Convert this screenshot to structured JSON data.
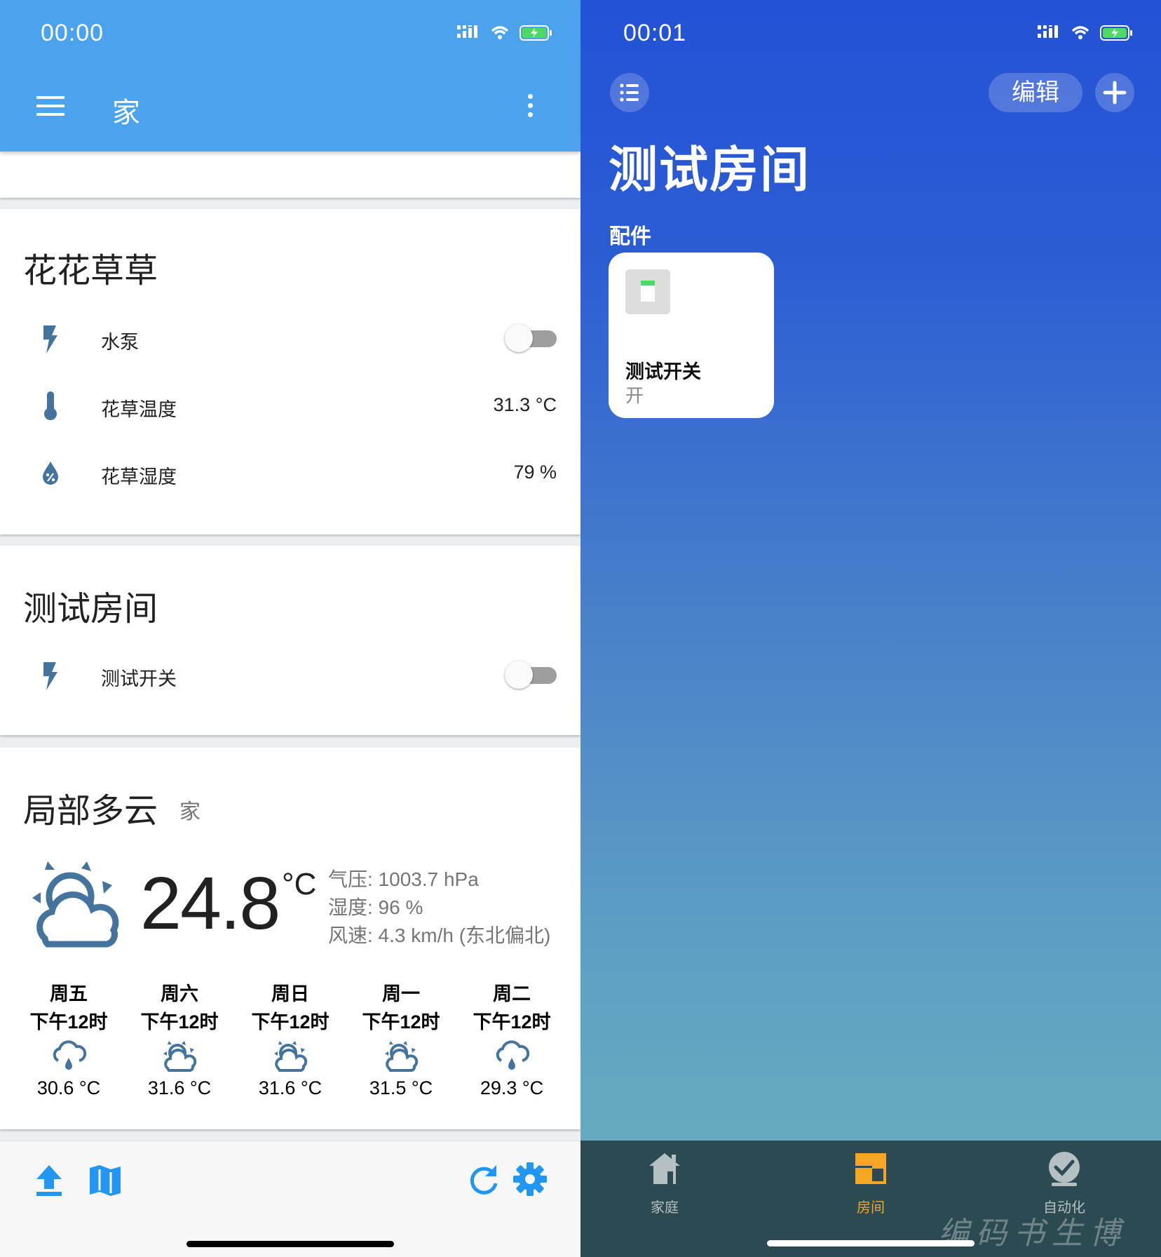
{
  "left": {
    "status": {
      "time": "00:00"
    },
    "header": {
      "title": "家"
    },
    "cards": [
      {
        "title": "花花草草",
        "rows": [
          {
            "icon": "flash-icon",
            "label": "水泵",
            "type": "toggle",
            "state": "off"
          },
          {
            "icon": "thermometer-icon",
            "label": "花草温度",
            "value": "31.3 °C"
          },
          {
            "icon": "water-percent-icon",
            "label": "花草湿度",
            "value": "79 %"
          }
        ]
      },
      {
        "title": "测试房间",
        "rows": [
          {
            "icon": "flash-icon",
            "label": "测试开关",
            "type": "toggle",
            "state": "off"
          }
        ]
      }
    ],
    "weather": {
      "state": "局部多云",
      "name": "家",
      "temperature": "24.8",
      "unit": "°C",
      "attributes": [
        "气压: 1003.7 hPa",
        "湿度: 96 %",
        "风速: 4.3 km/h (东北偏北)"
      ],
      "forecast": [
        {
          "day": "周五",
          "time": "下午12时",
          "icon": "rainy-icon",
          "temp": "30.6 °C"
        },
        {
          "day": "周六",
          "time": "下午12时",
          "icon": "partly-cloudy-icon",
          "temp": "31.6 °C"
        },
        {
          "day": "周日",
          "time": "下午12时",
          "icon": "partly-cloudy-icon",
          "temp": "31.6 °C"
        },
        {
          "day": "周一",
          "time": "下午12时",
          "icon": "partly-cloudy-icon",
          "temp": "31.5 °C"
        },
        {
          "day": "周二",
          "time": "下午12时",
          "icon": "rainy-icon",
          "temp": "29.3 °C"
        }
      ]
    },
    "bottom_icons": [
      "upload-icon",
      "map-icon",
      "refresh-icon",
      "settings-icon"
    ],
    "colors": {
      "header": "#4aa3ec",
      "icon": "#44739e",
      "accent": "#2196f3"
    }
  },
  "right": {
    "status": {
      "time": "00:01"
    },
    "toolbar": {
      "edit_label": "编辑"
    },
    "room_title": "测试房间",
    "section": "配件",
    "accessory": {
      "name": "测试开关",
      "status": "开"
    },
    "tabs": [
      {
        "label": "家庭",
        "icon": "house-icon",
        "active": false
      },
      {
        "label": "房间",
        "icon": "rooms-icon",
        "active": true
      },
      {
        "label": "自动化",
        "icon": "automation-icon",
        "active": false
      }
    ],
    "watermark": "编码书生博客",
    "colors": {
      "active_tab": "#f5a623",
      "tabbar": "#2b4a52"
    }
  }
}
